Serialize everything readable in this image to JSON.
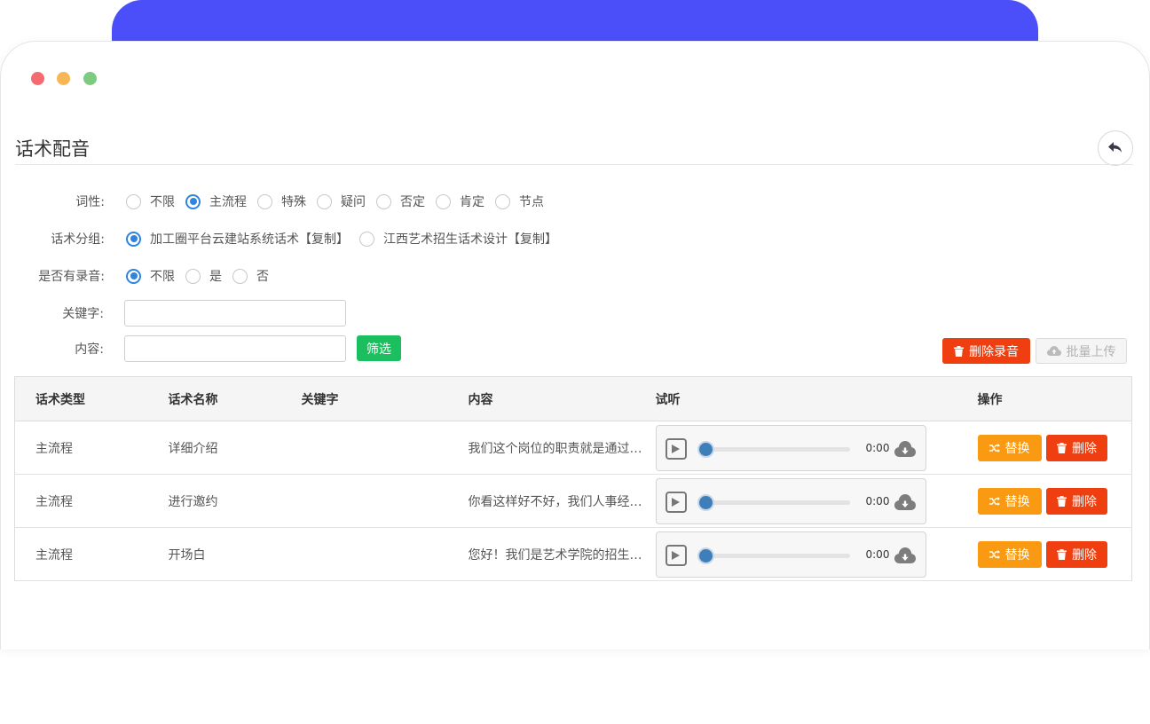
{
  "page": {
    "title": "话术配音"
  },
  "filters": {
    "part_of_speech": {
      "label": "词性:",
      "options": [
        "不限",
        "主流程",
        "特殊",
        "疑问",
        "否定",
        "肯定",
        "节点"
      ],
      "selected": "主流程"
    },
    "script_group": {
      "label": "话术分组:",
      "options": [
        "加工圈平台云建站系统话术【复制】",
        "江西艺术招生话术设计【复制】"
      ],
      "selected": "加工圈平台云建站系统话术【复制】"
    },
    "has_recording": {
      "label": "是否有录音:",
      "options": [
        "不限",
        "是",
        "否"
      ],
      "selected": "不限"
    },
    "keyword": {
      "label": "关键字:",
      "value": ""
    },
    "content": {
      "label": "内容:",
      "value": ""
    },
    "filter_button": "筛选"
  },
  "actions": {
    "delete_recording": "删除录音",
    "batch_upload": "批量上传"
  },
  "table": {
    "headers": [
      "话术类型",
      "话术名称",
      "关键字",
      "内容",
      "试听",
      "操作"
    ],
    "rows": [
      {
        "type": "主流程",
        "name": "详细介绍",
        "keyword": "",
        "content": "我们这个岗位的职责就是通过…",
        "time": "0:00"
      },
      {
        "type": "主流程",
        "name": "进行邀约",
        "keyword": "",
        "content": "你看这样好不好，我们人事经…",
        "time": "0:00"
      },
      {
        "type": "主流程",
        "name": "开场白",
        "keyword": "",
        "content": "您好！我们是艺术学院的招生…",
        "time": "0:00"
      }
    ],
    "row_actions": {
      "replace": "替换",
      "delete": "删除"
    }
  },
  "colors": {
    "accent_blue": "#4a4ff9",
    "radio_blue": "#2f84de",
    "filter_green": "#1bbf5f",
    "danger_red": "#ef3e0f",
    "warn_orange": "#fa9a12"
  }
}
